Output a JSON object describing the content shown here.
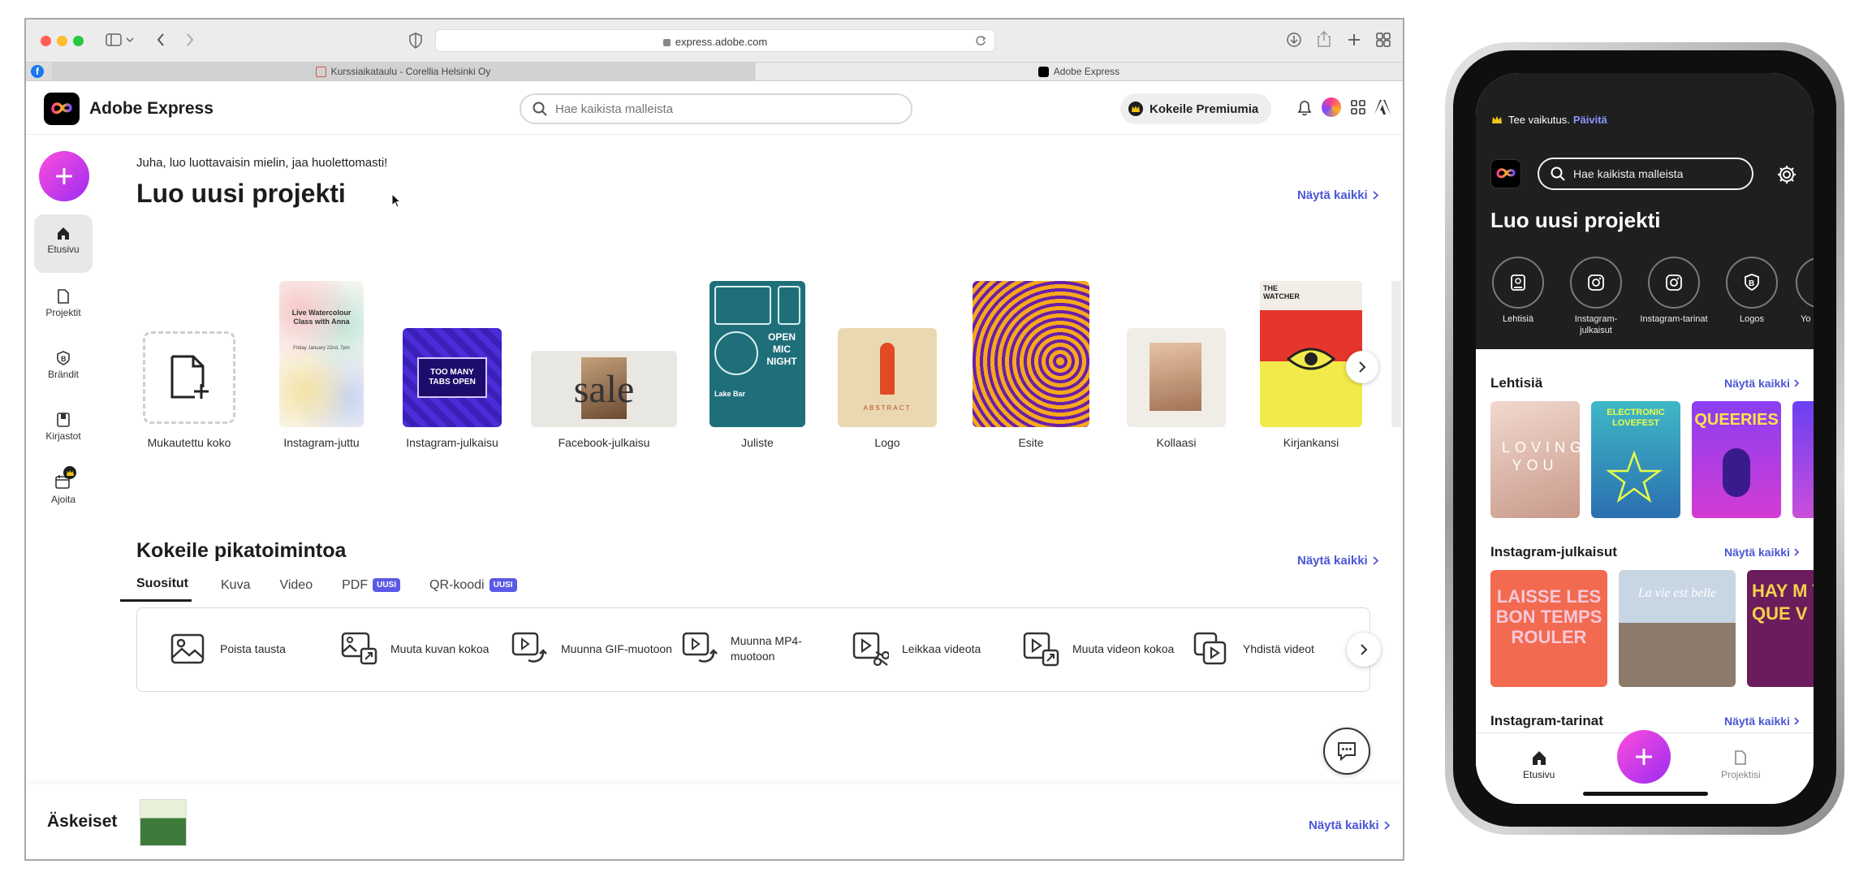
{
  "browser": {
    "url": "express.adobe.com",
    "tabs": [
      {
        "label": "Kurssiaikataulu - Corellia Helsinki Oy"
      },
      {
        "label": "Adobe Express"
      }
    ]
  },
  "header": {
    "brand": "Adobe Express",
    "search_placeholder": "Hae kaikista malleista",
    "premium_label": "Kokeile Premiumia"
  },
  "rail": {
    "items": [
      {
        "label": "Etusivu",
        "icon": "home-icon"
      },
      {
        "label": "Projektit",
        "icon": "file-icon"
      },
      {
        "label": "Brändit",
        "icon": "brand-icon"
      },
      {
        "label": "Kirjastot",
        "icon": "library-icon"
      },
      {
        "label": "Ajoita",
        "icon": "calendar-icon"
      }
    ]
  },
  "main": {
    "greeting": "Juha, luo luottavaisin mielin, jaa huolettomasti!",
    "create_title": "Luo uusi projekti",
    "show_all": "Näytä kaikki",
    "templates": [
      {
        "label": "Mukautettu koko"
      },
      {
        "label": "Instagram-juttu",
        "text": "Live Watercolour Class with Anna",
        "sub": "Friday January 22nd, 7pm"
      },
      {
        "label": "Instagram-julkaisu",
        "text": "TOO MANY TABS OPEN"
      },
      {
        "label": "Facebook-julkaisu",
        "text": "sale"
      },
      {
        "label": "Juliste",
        "text": "OPEN MIC NIGHT",
        "sub": "Lake Bar"
      },
      {
        "label": "Logo",
        "text": "ABSTRACT"
      },
      {
        "label": "Esite"
      },
      {
        "label": "Kollaasi"
      },
      {
        "label": "Kirjankansi",
        "text": "THE WATCHER"
      }
    ],
    "quick_title": "Kokeile pikatoimintoa",
    "quick_tabs": [
      {
        "label": "Suositut"
      },
      {
        "label": "Kuva"
      },
      {
        "label": "Video"
      },
      {
        "label": "PDF",
        "badge": "UUSI"
      },
      {
        "label": "QR-koodi",
        "badge": "UUSI"
      }
    ],
    "quick_actions": [
      {
        "label": "Poista tausta",
        "icon": "image-icon"
      },
      {
        "label": "Muuta kuvan kokoa",
        "icon": "image-resize-icon"
      },
      {
        "label": "Muunna GIF-muotoon",
        "icon": "gif-convert-icon"
      },
      {
        "label": "Muunna MP4-muotoon",
        "icon": "mp4-convert-icon"
      },
      {
        "label": "Leikkaa videota",
        "icon": "video-trim-icon"
      },
      {
        "label": "Muuta videon kokoa",
        "icon": "video-resize-icon"
      },
      {
        "label": "Yhdistä videot",
        "icon": "video-merge-icon"
      }
    ],
    "recent_title": "Äskeiset"
  },
  "phone": {
    "banner_text": "Tee vaikutus.",
    "banner_link": "Päivitä",
    "search_placeholder": "Hae kaikista malleista",
    "create_title": "Luo uusi projekti",
    "shortcuts": [
      {
        "label": "Lehtisiä"
      },
      {
        "label": "Instagram-julkaisut"
      },
      {
        "label": "Instagram-tarinat"
      },
      {
        "label": "Logos"
      },
      {
        "label": "Yo pi"
      }
    ],
    "sections": [
      {
        "title": "Lehtisiä",
        "show": "Näytä kaikki"
      },
      {
        "title": "Instagram-julkaisut",
        "show": "Näytä kaikki"
      },
      {
        "title": "Instagram-tarinat",
        "show": "Näytä kaikki"
      }
    ],
    "flyer_texts": [
      "LOVING YOU",
      "ELECTRONIC LOVEFEST",
      "QUEERIES"
    ],
    "post_texts": [
      "LAISSE LES BON TEMPS ROULER",
      "La vie est belle",
      "HAY M TIEM QUE V"
    ],
    "nav": [
      {
        "label": "Etusivu"
      },
      {
        "label": "Projektisi"
      }
    ]
  },
  "colors": {
    "accent": "#4a56d6",
    "fab_start": "#ff4ddc",
    "fab_end": "#9b2cf2"
  }
}
